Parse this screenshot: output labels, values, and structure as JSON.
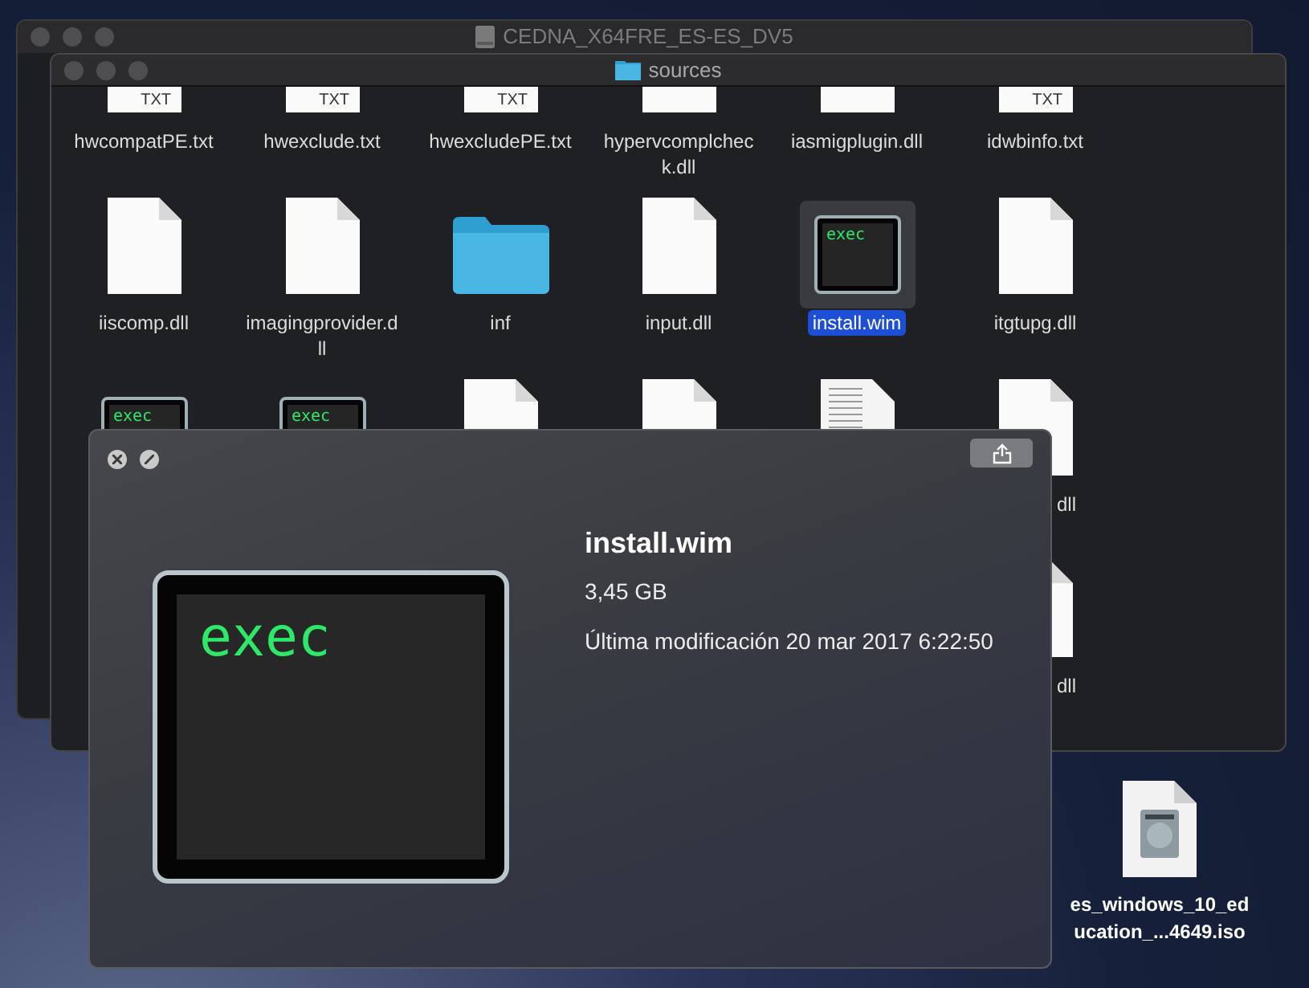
{
  "back_window": {
    "title": "CEDNA_X64FRE_ES-ES_DV5"
  },
  "front_window": {
    "title": "sources",
    "rows": [
      [
        {
          "kind": "txt",
          "badge": "TXT",
          "label_lines": [
            "hwcompatPE.txt"
          ],
          "selected": false
        },
        {
          "kind": "txt",
          "badge": "TXT",
          "label_lines": [
            "hwexclude.txt"
          ],
          "selected": false
        },
        {
          "kind": "txt",
          "badge": "TXT",
          "label_lines": [
            "hwexcludePE.txt"
          ],
          "selected": false
        },
        {
          "kind": "doc",
          "label_lines": [
            "hypervcomplchec",
            "k.dll"
          ],
          "selected": false
        },
        {
          "kind": "doc",
          "label_lines": [
            "iasmigplugin.dll"
          ],
          "selected": false
        },
        {
          "kind": "txt",
          "badge": "TXT",
          "label_lines": [
            "idwbinfo.txt"
          ],
          "selected": false
        }
      ],
      [
        {
          "kind": "doc",
          "label_lines": [
            "iiscomp.dll"
          ],
          "selected": false
        },
        {
          "kind": "doc",
          "label_lines": [
            "imagingprovider.d",
            "ll"
          ],
          "selected": false
        },
        {
          "kind": "folder",
          "label_lines": [
            "inf"
          ],
          "selected": false
        },
        {
          "kind": "doc",
          "label_lines": [
            "input.dll"
          ],
          "selected": false
        },
        {
          "kind": "exec",
          "icon_text": "exec",
          "label_lines": [
            "install.wim"
          ],
          "selected": true
        },
        {
          "kind": "doc",
          "label_lines": [
            "itgtupg.dll"
          ],
          "selected": false
        }
      ],
      [
        {
          "kind": "exec",
          "icon_text": "exec",
          "selected": false
        },
        {
          "kind": "exec",
          "icon_text": "exec",
          "selected": false
        },
        {
          "kind": "doc",
          "selected": false
        },
        {
          "kind": "doc",
          "selected": false
        },
        {
          "kind": "textdoc",
          "selected": false
        },
        {
          "kind": "doc",
          "label_lines": [
            "dll"
          ],
          "selected": false
        }
      ],
      [
        {
          "kind": "blank"
        },
        {
          "kind": "blank"
        },
        {
          "kind": "blank"
        },
        {
          "kind": "blank"
        },
        {
          "kind": "blank"
        },
        {
          "kind": "doc",
          "label_lines": [
            "dll"
          ],
          "selected": false
        }
      ]
    ]
  },
  "quick_look": {
    "icon_text": "exec",
    "title": "install.wim",
    "size": "3,45 GB",
    "modified": "Última modificación 20 mar 2017 6:22:50"
  },
  "desktop_icon": {
    "label_lines": [
      "es_windows_10_ed",
      "ucation_...4649.iso"
    ]
  }
}
